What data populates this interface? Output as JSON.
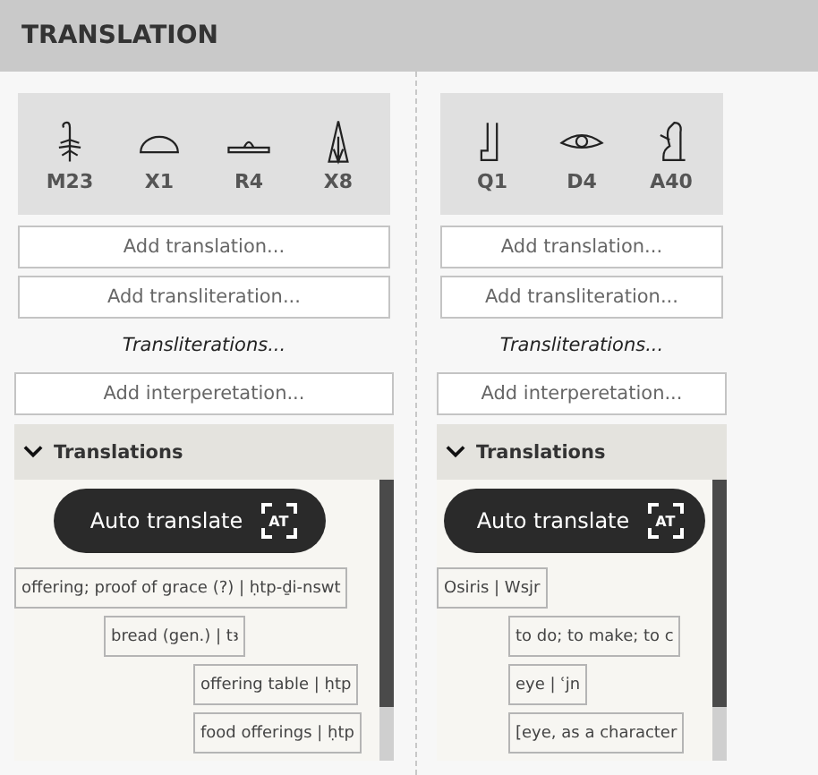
{
  "header": {
    "title": "TRANSLATION"
  },
  "columns": [
    {
      "glyphs": [
        {
          "kind": "sedge",
          "code": "M23"
        },
        {
          "kind": "bread",
          "code": "X1"
        },
        {
          "kind": "mat",
          "code": "R4"
        },
        {
          "kind": "cone",
          "code": "X8"
        }
      ],
      "add_translation": "Add translation...",
      "add_transliteration": "Add transliteration...",
      "transliterations": "Transliterations...",
      "add_interpretation": "Add interperetation...",
      "section": {
        "title": "Translations",
        "expanded": true,
        "auto_translate": {
          "label": "Auto translate",
          "badge": "AT"
        },
        "items": [
          {
            "text": "offering; proof of grace (?) | ḥtp-ḏi-nswt",
            "children": [
              {
                "text": "bread (gen.) | tꜣ",
                "children": [
                  {
                    "text": "offering table | ḥtp"
                  },
                  {
                    "text": "food offerings | ḥtp"
                  }
                ]
              }
            ]
          }
        ]
      }
    },
    {
      "glyphs": [
        {
          "kind": "seat",
          "code": "Q1"
        },
        {
          "kind": "eye",
          "code": "D4"
        },
        {
          "kind": "god",
          "code": "A40"
        }
      ],
      "add_translation": "Add translation...",
      "add_transliteration": "Add transliteration...",
      "transliterations": "Transliterations...",
      "add_interpretation": "Add interperetation...",
      "section": {
        "title": "Translations",
        "expanded": true,
        "auto_translate": {
          "label": "Auto translate",
          "badge": "AT"
        },
        "items": [
          {
            "text": "Osiris | Wsjr",
            "children": [
              {
                "text": "to do; to make; to c"
              },
              {
                "text": "eye | ʿjn"
              },
              {
                "text": "[eye, as a character"
              }
            ]
          }
        ]
      }
    }
  ]
}
